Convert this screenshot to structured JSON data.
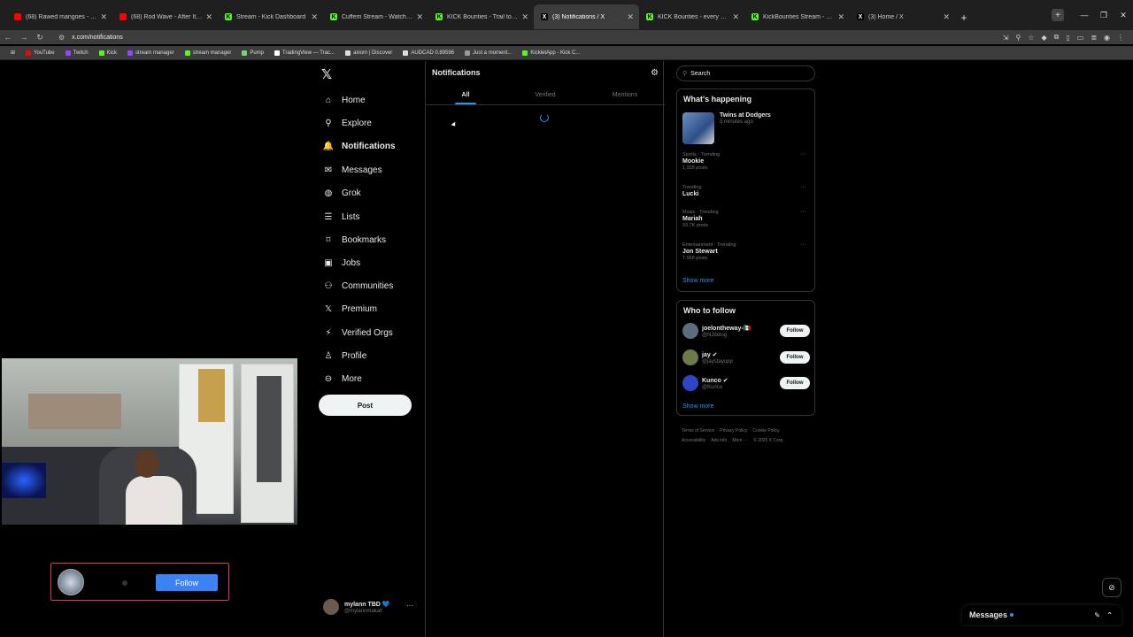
{
  "browser": {
    "tabs": [
      {
        "title": "(68) Rawed mangoes - YouT",
        "color": "#ff0000",
        "glyph": "",
        "active": false
      },
      {
        "title": "(68) Rod Wave - After It All",
        "color": "#ff0000",
        "glyph": "",
        "active": false
      },
      {
        "title": "Stream - Kick Dashboard",
        "color": "#53fc18",
        "glyph": "K",
        "active": false
      },
      {
        "title": "Cuffem Stream - Watch Live on",
        "color": "#53fc18",
        "glyph": "K",
        "active": false
      },
      {
        "title": "KICK Bounties - Trail to Trevor",
        "color": "#53fc18",
        "glyph": "K",
        "active": false
      },
      {
        "title": "(3) Notifications / X",
        "color": "#000000",
        "glyph": "X",
        "active": true
      },
      {
        "title": "KICK Bounties - every player fo",
        "color": "#53fc18",
        "glyph": "K",
        "active": false
      },
      {
        "title": "KickBounties Stream - Watch Li",
        "color": "#53fc18",
        "glyph": "K",
        "active": false
      },
      {
        "title": "(3) Home / X",
        "color": "#000000",
        "glyph": "X",
        "active": false
      }
    ],
    "new_tab_icon": "+",
    "url": "x.com/notifications",
    "bookmarks": [
      {
        "label": "YouTube",
        "color": "#ff0000"
      },
      {
        "label": "Twitch",
        "color": "#9146ff"
      },
      {
        "label": "Kick",
        "color": "#53fc18"
      },
      {
        "label": "stream manager",
        "color": "#9146ff"
      },
      {
        "label": "stream manager",
        "color": "#53fc18"
      },
      {
        "label": "Pump",
        "color": "#7ad17a"
      },
      {
        "label": "TradingView — Trac...",
        "color": "#ffffff"
      },
      {
        "label": "axiom | Discover",
        "color": "#dddddd"
      },
      {
        "label": "AUDCAD 0.89596",
        "color": "#dddddd"
      },
      {
        "label": "Just a moment...",
        "color": "#999999"
      },
      {
        "label": "KickletApp - Kick C...",
        "color": "#53fc18"
      }
    ]
  },
  "sidebar": {
    "logo": "𝕏",
    "items": [
      {
        "label": "Home",
        "icon": "⌂",
        "name": "home"
      },
      {
        "label": "Explore",
        "icon": "⚲",
        "name": "explore"
      },
      {
        "label": "Notifications",
        "icon": "🔔",
        "name": "notifications"
      },
      {
        "label": "Messages",
        "icon": "✉",
        "name": "messages"
      },
      {
        "label": "Grok",
        "icon": "◍",
        "name": "grok"
      },
      {
        "label": "Lists",
        "icon": "☰",
        "name": "lists"
      },
      {
        "label": "Bookmarks",
        "icon": "⌑",
        "name": "bookmarks"
      },
      {
        "label": "Jobs",
        "icon": "▣",
        "name": "jobs"
      },
      {
        "label": "Communities",
        "icon": "⚇",
        "name": "communities"
      },
      {
        "label": "Premium",
        "icon": "𝕏",
        "name": "premium"
      },
      {
        "label": "Verified Orgs",
        "icon": "⚡",
        "name": "verified-orgs"
      },
      {
        "label": "Profile",
        "icon": "♙",
        "name": "profile"
      },
      {
        "label": "More",
        "icon": "⊖",
        "name": "more"
      }
    ],
    "post_label": "Post",
    "account": {
      "name": "mylann TBD 💙",
      "handle": "@mylannmakall",
      "more": "···"
    }
  },
  "main": {
    "title": "Notifications",
    "settings_icon": "⚙",
    "tabs": [
      "All",
      "Verified",
      "Mentions"
    ]
  },
  "right": {
    "search_placeholder": "Search",
    "happening": {
      "title": "What's happening",
      "feature": {
        "title": "Twins at Dodgers",
        "subtitle": "5 minutes ago"
      },
      "trends": [
        {
          "category": "Sports · Trending",
          "name": "Mookie",
          "count": "1,928 posts"
        },
        {
          "category": "Trending",
          "name": "Lucki",
          "count": ""
        },
        {
          "category": "Music · Trending",
          "name": "Mariah",
          "count": "33.7K posts"
        },
        {
          "category": "Entertainment · Trending",
          "name": "Jon Stewart",
          "count": "7,968 posts"
        }
      ],
      "show_more": "Show more"
    },
    "who_to_follow": {
      "title": "Who to follow",
      "users": [
        {
          "name": "joelontheway-🇲🇽",
          "handle": "@NJdelog",
          "avatar_color": "#5b6d7e"
        },
        {
          "name": "jay ✔",
          "handle": "@jaystayupp",
          "avatar_color": "#6d7a4a"
        },
        {
          "name": "Kunco ✔",
          "handle": "@Kunco",
          "avatar_color": "#2f45c9"
        }
      ],
      "follow_label": "Follow",
      "show_more": "Show more"
    },
    "footer": [
      "Terms of Service",
      "Privacy Policy",
      "Cookie Policy",
      "Accessibility",
      "Ads info",
      "More ···",
      "© 2025 X Corp."
    ]
  },
  "overlay": {
    "follow_label": "Follow"
  },
  "messages_drawer": {
    "label": "Messages"
  }
}
